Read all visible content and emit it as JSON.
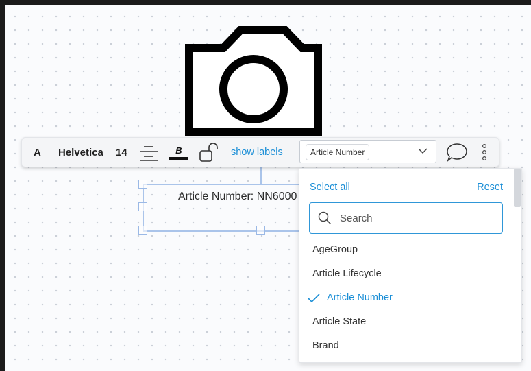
{
  "canvas": {
    "article_field_text": "Article Number: NN6000"
  },
  "toolbar": {
    "font_glyph": "A",
    "font_family": "Helvetica",
    "font_size": "14",
    "align_icon": "align-center-icon",
    "bold_icon": "bold-underline-icon",
    "bold_glyph": "B",
    "lock_icon": "unlock-icon",
    "show_labels": "show labels",
    "field_select": {
      "selected_chip": "Article Number"
    },
    "comment_icon": "comment-icon",
    "more_icon": "more-vertical-icon"
  },
  "dropdown": {
    "select_all": "Select all",
    "reset": "Reset",
    "search_placeholder": "Search",
    "options": [
      {
        "label": "AgeGroup",
        "selected": false
      },
      {
        "label": "Article Lifecycle",
        "selected": false
      },
      {
        "label": "Article Number",
        "selected": true
      },
      {
        "label": "Article State",
        "selected": false
      },
      {
        "label": "Brand",
        "selected": false
      }
    ]
  },
  "colors": {
    "accent": "#1a8ed6",
    "selection": "#9bb9e6"
  }
}
